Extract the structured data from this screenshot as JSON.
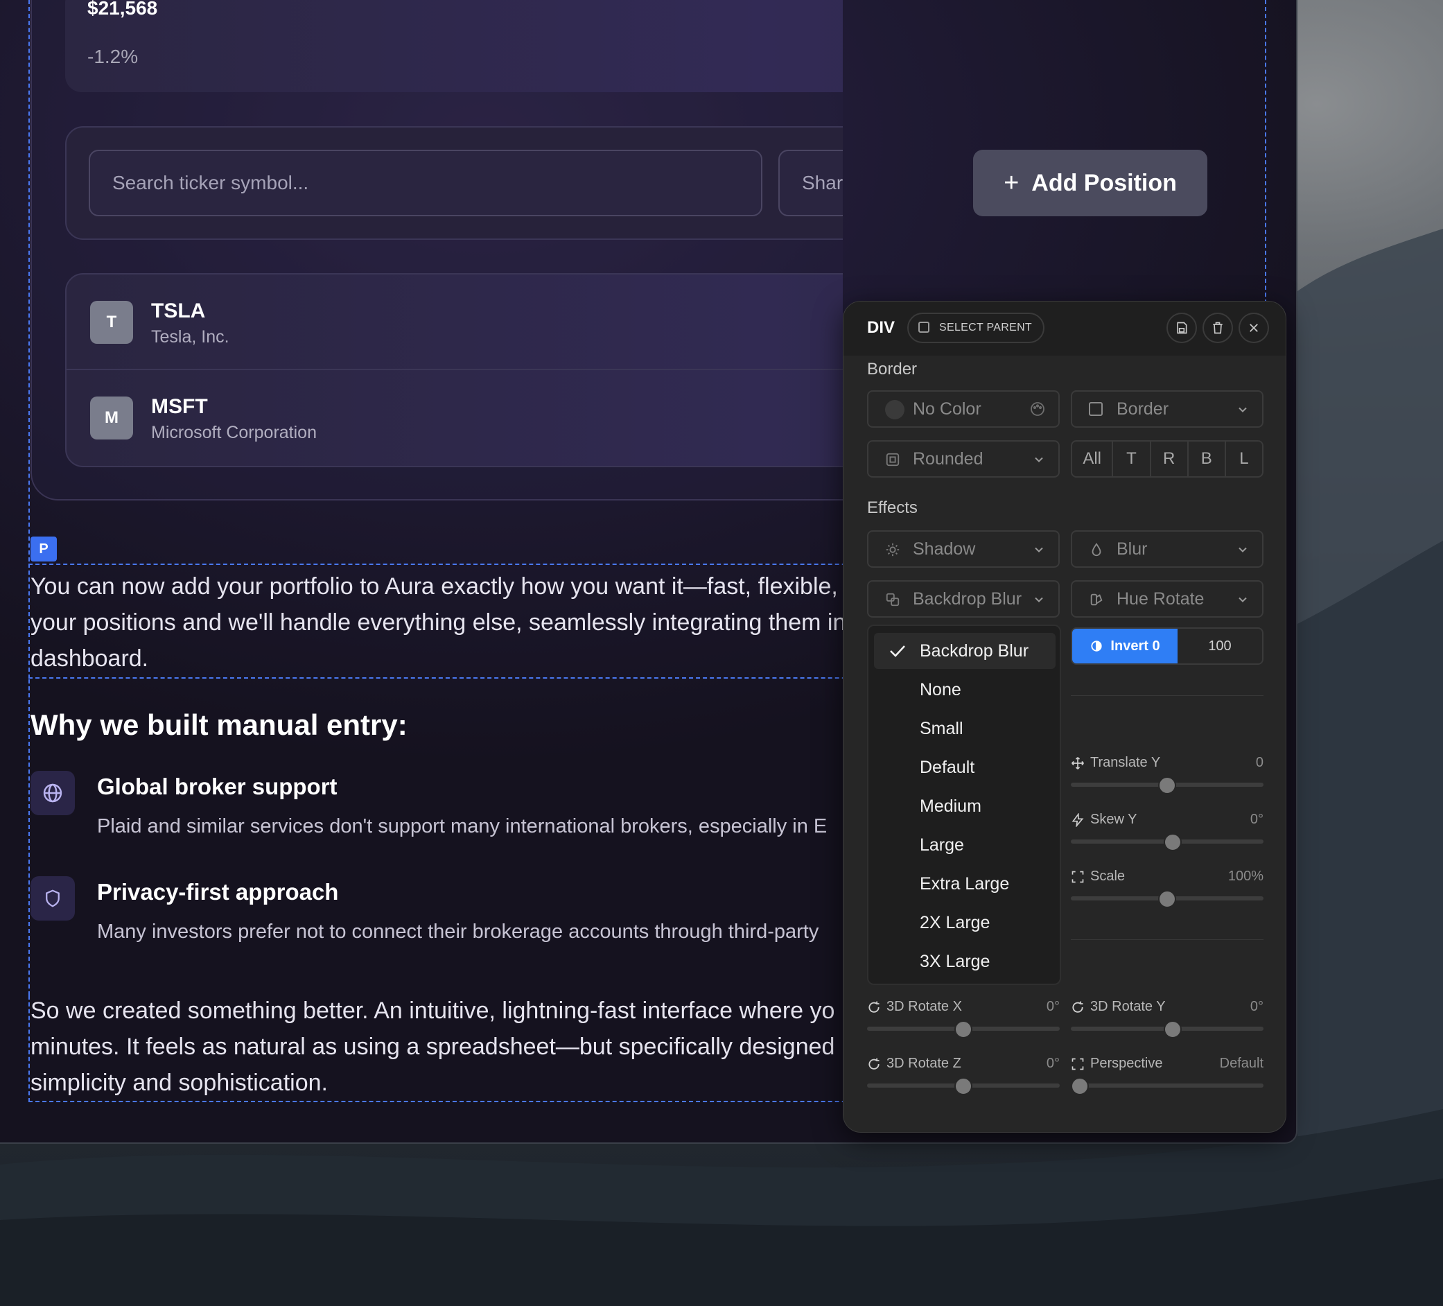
{
  "portfolio": {
    "total_value": "$21,568",
    "change": "-1.2%"
  },
  "entry": {
    "search_placeholder": "Search ticker symbol...",
    "shares_placeholder": "Shares",
    "add_label": "Add Position"
  },
  "positions": [
    {
      "avatar": "T",
      "ticker": "TSLA",
      "company": "Tesla, Inc."
    },
    {
      "avatar": "M",
      "ticker": "MSFT",
      "company": "Microsoft Corporation"
    }
  ],
  "content": {
    "p_tag": "P",
    "intro_line1": "You can now add your portfolio to Aura exactly how you want it—fast, flexible,",
    "intro_line2": "your positions and we'll handle everything else, seamlessly integrating them in",
    "intro_line3": "dashboard.",
    "heading": "Why we built manual entry:",
    "features": [
      {
        "icon": "globe-icon",
        "title": "Global broker support",
        "desc": "Plaid and similar services don't support many international brokers, especially in E"
      },
      {
        "icon": "shield-icon",
        "title": "Privacy-first approach",
        "desc": "Many investors prefer not to connect their brokerage accounts through third-party"
      }
    ],
    "outro_line1": "So we created something better. An intuitive, lightning-fast interface where yo",
    "outro_line2": "minutes. It feels as natural as using a spreadsheet—but specifically designed",
    "outro_line3": "simplicity and sophistication."
  },
  "inspector": {
    "element_type": "DIV",
    "select_parent": "SELECT PARENT",
    "border_section": "Border",
    "color_value": "No Color",
    "border_style": "Border",
    "radius": "Rounded",
    "sides": [
      "All",
      "T",
      "R",
      "B",
      "L"
    ],
    "effects_section": "Effects",
    "shadow": "Shadow",
    "blur": "Blur",
    "backdrop_blur": "Backdrop Blur",
    "hue_rotate": "Hue Rotate",
    "invert_label": "Invert 0",
    "invert_value": "100",
    "sliders": [
      {
        "label": "Translate Y",
        "value": "0",
        "icon": "move-icon",
        "level": 0.5
      },
      {
        "label": "Skew Y",
        "value": "0°",
        "icon": "bolt-icon",
        "level": 0.53
      },
      {
        "label": "Scale",
        "value": "100%",
        "icon": "expand-icon",
        "level": 0.5
      }
    ],
    "rotate_sliders": [
      {
        "label": "3D Rotate X",
        "value": "0°",
        "icon": "rotate-icon",
        "level": 0.5
      },
      {
        "label": "3D Rotate Y",
        "value": "0°",
        "icon": "rotate-icon",
        "level": 0.53
      },
      {
        "label": "3D Rotate Z",
        "value": "0°",
        "icon": "rotate-icon",
        "level": 0.5
      },
      {
        "label": "Perspective",
        "value": "Default",
        "icon": "expand-icon",
        "level": 0.0
      }
    ],
    "dropdown": {
      "selected": "Backdrop Blur",
      "options": [
        "None",
        "Small",
        "Default",
        "Medium",
        "Large",
        "Extra Large",
        "2X Large",
        "3X Large"
      ]
    }
  },
  "colors": {
    "accent": "#2f7ef5",
    "selection_outline": "#4a78f0",
    "panel_bg": "#262626"
  }
}
